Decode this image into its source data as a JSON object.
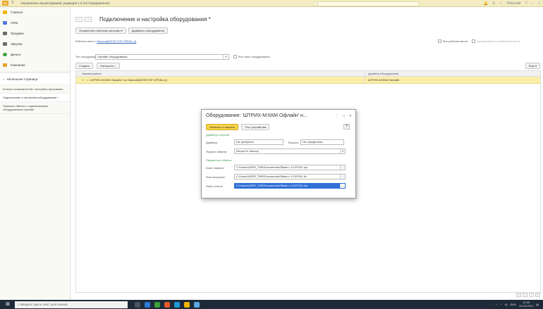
{
  "titlebar": {
    "logo": "1С",
    "app_title": "Управление нашей фирмой, редакция 1.6 (1С:Предприятие)",
    "search_placeholder": "Q",
    "user": "Николай"
  },
  "sidebar": {
    "sections": [
      {
        "label": "Главное",
        "color": "#f0b400"
      },
      {
        "label": "CRM",
        "color": "#4d7bd6"
      },
      {
        "label": "Продажи",
        "color": "#6b6b6b"
      },
      {
        "label": "Закупки",
        "color": "#6b6b6b"
      },
      {
        "label": "Деньги",
        "color": "#3aa23a"
      },
      {
        "label": "Компания",
        "color": "#e9a02a"
      }
    ],
    "home": "Начальная страница",
    "nav": [
      "Больше возможностей: настройка программы",
      "Подключение и настройка оборудования *",
      "Правила обмена с подключаемым оборудованием офлайн"
    ]
  },
  "main": {
    "title": "Подключение и настройка оборудования *",
    "btn_workplaces": "Управление рабочими местами",
    "btn_drivers": "Драйверы оборудования",
    "workplace_label": "Рабочее место:",
    "workplace_value": "Николай(DESKTOP-OPK6LL4)",
    "type_label": "Тип оборудования:",
    "type_value": "Офлайн оборудование",
    "all_types": "Все типы оборудования",
    "all_workplaces": "Все рабочие места",
    "group_by_workplace": "Группировать по рабочему месту",
    "btn_create": "Создать",
    "btn_configure": "Настроить...",
    "btn_more": "Еще",
    "col_name": "Наименование",
    "col_driver": "Драйвер оборудования",
    "row_name": "ШТРИХ-М:ККМ Офлайн\" на Николай(DESKTOP-OPK6LL4)",
    "row_driver": "ШТРИХ-М:ККМ Офлайн"
  },
  "dialog": {
    "title": "Оборудование: 'ШТРИХ-М:ККМ Офлайн' н...",
    "btn_save_close": "Записать и закрыть",
    "btn_test": "Тест устройства",
    "help": "?",
    "sec_driver": "Драйвер и версия",
    "driver_label": "Драйвер:",
    "driver_value": "Не требуется",
    "version_label": "Версия:",
    "version_value": "Не определена",
    "format_label": "Формат обмена:",
    "format_value": "Штрих-М: Кассир",
    "sec_params": "Параметры обмена",
    "goods_label": "База товаров:",
    "goods_value": "C:\\Users\\USER_TMS\\Documents\\Обмен с 1С\\POS1.spr",
    "flag_label": "Флаг выгрузки:",
    "flag_value": "C:\\Users\\USER_TMS\\Documents\\Обмен с 1С\\POS1.flz",
    "report_label": "Файл отчета:",
    "report_value": "C:\\Users\\USER_TMS\\Documents\\Обмен с 1С\\POS1.rep"
  },
  "taskbar": {
    "search": "Введите здесь текст для поиска",
    "lang": "ENG",
    "time": "10:29",
    "date": "03.04.2021"
  }
}
